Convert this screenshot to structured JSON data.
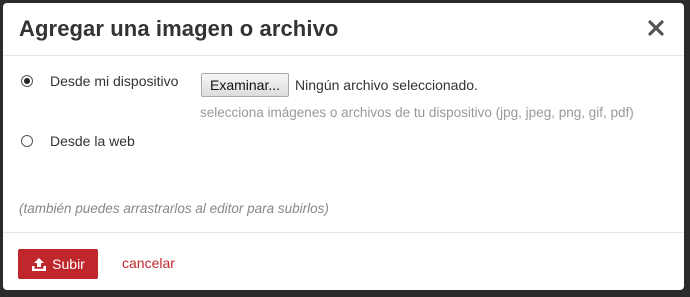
{
  "dialog": {
    "title": "Agregar una imagen o archivo",
    "close_icon": "close-icon"
  },
  "options": [
    {
      "label": "Desde mi dispositivo",
      "selected": true
    },
    {
      "label": "Desde la web",
      "selected": false
    }
  ],
  "file_input": {
    "button_label": "Examinar...",
    "status": "Ningún archivo seleccionado.",
    "hint": "selecciona imágenes o archivos de tu dispositivo (jpg, jpeg, png, gif, pdf)"
  },
  "drag_note": "(también puedes arrastrarlos al editor para subirlos)",
  "footer": {
    "submit_label": "Subir",
    "submit_icon": "upload-icon",
    "cancel_label": "cancelar"
  },
  "colors": {
    "accent": "#c0272d",
    "backdrop": "#2b2b2b",
    "hint_text": "#999999"
  }
}
